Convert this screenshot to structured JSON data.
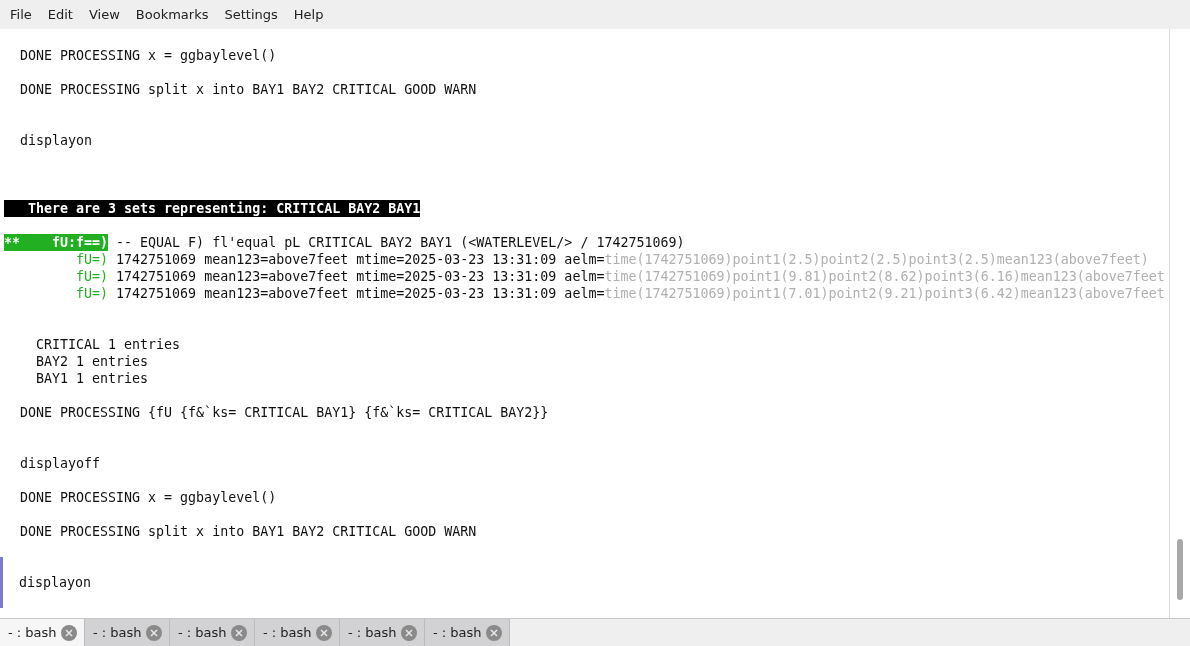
{
  "menu": [
    "File",
    "Edit",
    "View",
    "Bookmarks",
    "Settings",
    "Help"
  ],
  "lines": [
    {
      "kind": "text",
      "text": "DONE PROCESSING x = ggbaylevel()"
    },
    {
      "kind": "blank"
    },
    {
      "kind": "text",
      "text": "DONE PROCESSING split x into BAY1 BAY2 CRITICAL GOOD WARN"
    },
    {
      "kind": "blank"
    },
    {
      "kind": "blank"
    },
    {
      "kind": "text",
      "text": "displayon"
    },
    {
      "kind": "blank"
    },
    {
      "kind": "blank"
    },
    {
      "kind": "blank"
    },
    {
      "kind": "banner",
      "text": "There are 3 sets representing: CRITICAL BAY2 BAY1"
    },
    {
      "kind": "blank"
    },
    {
      "kind": "match",
      "marker": "**",
      "label": "fU:f==)",
      "text": "-- EQUAL F) fl'equal pL CRITICAL BAY2 BAY1 (<WATERLEVEL/> / 1742751069)"
    },
    {
      "kind": "detail",
      "label": "fU=)",
      "text": "1742751069 mean123=above7feet mtime=2025-03-23 13:31:09 aelm=",
      "dim": "time(1742751069)point1(2.5)point2(2.5)point3(2.5)mean123(above7feet)"
    },
    {
      "kind": "detail",
      "label": "fU=)",
      "text": "1742751069 mean123=above7feet mtime=2025-03-23 13:31:09 aelm=",
      "dim": "time(1742751069)point1(9.81)point2(8.62)point3(6.16)mean123(above7feet"
    },
    {
      "kind": "detail",
      "label": "fU=)",
      "text": "1742751069 mean123=above7feet mtime=2025-03-23 13:31:09 aelm=",
      "dim": "time(1742751069)point1(7.01)point2(9.21)point3(6.42)mean123(above7feet"
    },
    {
      "kind": "blank"
    },
    {
      "kind": "blank"
    },
    {
      "kind": "entry",
      "text": "CRITICAL 1 entries"
    },
    {
      "kind": "entry",
      "text": "BAY2 1 entries"
    },
    {
      "kind": "entry",
      "text": "BAY1 1 entries"
    },
    {
      "kind": "blank"
    },
    {
      "kind": "text",
      "text": "DONE PROCESSING {fU {f&`ks= CRITICAL BAY1} {f&`ks= CRITICAL BAY2}}"
    },
    {
      "kind": "blank"
    },
    {
      "kind": "blank"
    },
    {
      "kind": "text",
      "text": "displayoff"
    },
    {
      "kind": "blank"
    },
    {
      "kind": "text",
      "text": "DONE PROCESSING x = ggbaylevel()"
    },
    {
      "kind": "blank"
    },
    {
      "kind": "text",
      "text": "DONE PROCESSING split x into BAY1 BAY2 CRITICAL GOOD WARN"
    },
    {
      "kind": "blank"
    },
    {
      "kind": "marked",
      "text": "displayon"
    }
  ],
  "tabs": [
    {
      "label": "- : bash",
      "selected": true
    },
    {
      "label": "- : bash",
      "selected": false
    },
    {
      "label": "- : bash",
      "selected": false
    },
    {
      "label": "- : bash",
      "selected": false
    },
    {
      "label": "- : bash",
      "selected": false
    },
    {
      "label": "- : bash",
      "selected": false
    }
  ]
}
